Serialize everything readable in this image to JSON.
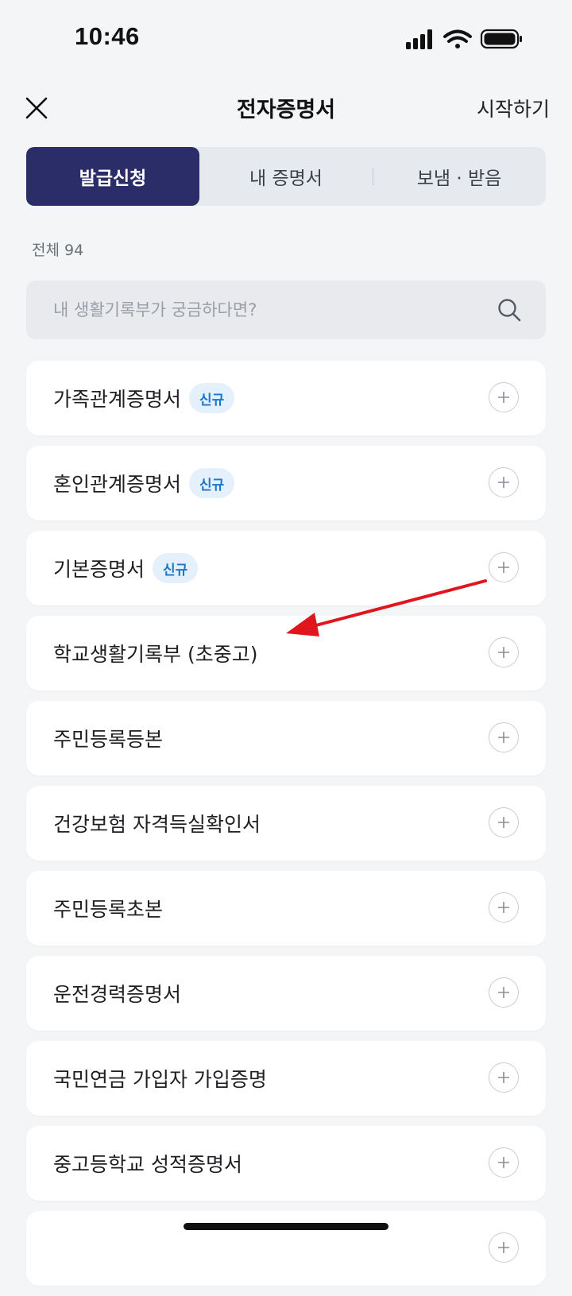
{
  "status_bar": {
    "time": "10:46"
  },
  "nav": {
    "title": "전자증명서",
    "action_label": "시작하기"
  },
  "tabs": [
    {
      "label": "발급신청",
      "active": true
    },
    {
      "label": "내 증명서",
      "active": false
    },
    {
      "label": "보냄 · 받음",
      "active": false
    }
  ],
  "total_label": "전체 94",
  "search": {
    "placeholder": "내 생활기록부가 궁금하다면?"
  },
  "items": [
    {
      "label": "가족관계증명서",
      "badge": "신규"
    },
    {
      "label": "혼인관계증명서",
      "badge": "신규"
    },
    {
      "label": "기본증명서",
      "badge": "신규"
    },
    {
      "label": "학교생활기록부 (초중고)",
      "badge": ""
    },
    {
      "label": "주민등록등본",
      "badge": ""
    },
    {
      "label": "건강보험 자격득실확인서",
      "badge": ""
    },
    {
      "label": "주민등록초본",
      "badge": ""
    },
    {
      "label": "운전경력증명서",
      "badge": ""
    },
    {
      "label": "국민연금 가입자 가입증명",
      "badge": ""
    },
    {
      "label": "중고등학교 성적증명서",
      "badge": ""
    },
    {
      "label": "",
      "badge": ""
    }
  ],
  "colors": {
    "active_tab": "#2b2d69",
    "badge_text": "#1b75c9",
    "badge_bg": "#e4f0fb",
    "annotation_arrow": "#e0161c"
  }
}
